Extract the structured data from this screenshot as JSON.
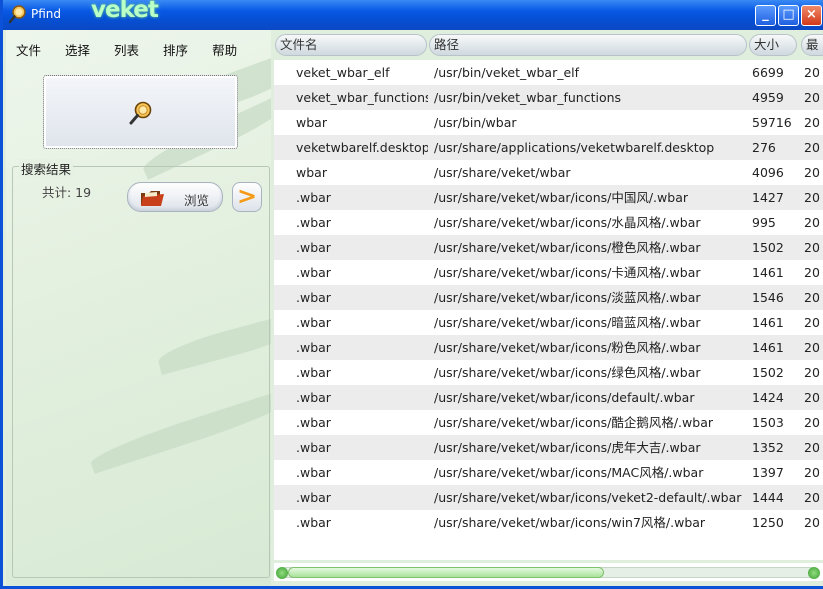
{
  "window": {
    "title": "Pfind",
    "logo_text": "veket",
    "controls": {
      "minimize": "_",
      "maximize": "□",
      "close": "×"
    }
  },
  "menu": [
    "文件",
    "选择",
    "列表",
    "排序",
    "帮助"
  ],
  "search_panel": {
    "search_icon": "magnifier-icon",
    "group_title": "搜索结果",
    "count_label": "共计: 19",
    "browse_label": "浏览",
    "next_symbol": ">"
  },
  "table": {
    "columns": [
      "文件名",
      "路径",
      "大小",
      "最"
    ],
    "rows": [
      [
        "veket_wbar_elf",
        "/usr/bin/veket_wbar_elf",
        "6699",
        "20"
      ],
      [
        "veket_wbar_functions",
        "/usr/bin/veket_wbar_functions",
        "4959",
        "20"
      ],
      [
        "wbar",
        "/usr/bin/wbar",
        "59716",
        "20"
      ],
      [
        "veketwbarelf.desktop",
        "/usr/share/applications/veketwbarelf.desktop",
        "276",
        "20"
      ],
      [
        "wbar",
        "/usr/share/veket/wbar",
        "4096",
        "20"
      ],
      [
        ".wbar",
        "/usr/share/veket/wbar/icons/中国风/.wbar",
        "1427",
        "20"
      ],
      [
        ".wbar",
        "/usr/share/veket/wbar/icons/水晶风格/.wbar",
        "995",
        "20"
      ],
      [
        ".wbar",
        "/usr/share/veket/wbar/icons/橙色风格/.wbar",
        "1502",
        "20"
      ],
      [
        ".wbar",
        "/usr/share/veket/wbar/icons/卡通风格/.wbar",
        "1461",
        "20"
      ],
      [
        ".wbar",
        "/usr/share/veket/wbar/icons/淡蓝风格/.wbar",
        "1546",
        "20"
      ],
      [
        ".wbar",
        "/usr/share/veket/wbar/icons/暗蓝风格/.wbar",
        "1461",
        "20"
      ],
      [
        ".wbar",
        "/usr/share/veket/wbar/icons/粉色风格/.wbar",
        "1461",
        "20"
      ],
      [
        ".wbar",
        "/usr/share/veket/wbar/icons/绿色风格/.wbar",
        "1502",
        "20"
      ],
      [
        ".wbar",
        "/usr/share/veket/wbar/icons/default/.wbar",
        "1424",
        "20"
      ],
      [
        ".wbar",
        "/usr/share/veket/wbar/icons/酷企鹅风格/.wbar",
        "1503",
        "20"
      ],
      [
        ".wbar",
        "/usr/share/veket/wbar/icons/虎年大吉/.wbar",
        "1352",
        "20"
      ],
      [
        ".wbar",
        "/usr/share/veket/wbar/icons/MAC风格/.wbar",
        "1397",
        "20"
      ],
      [
        ".wbar",
        "/usr/share/veket/wbar/icons/veket2-default/.wbar",
        "1444",
        "20"
      ],
      [
        ".wbar",
        "/usr/share/veket/wbar/icons/win7风格/.wbar",
        "1250",
        "20"
      ]
    ]
  },
  "colors": {
    "titlebar": "#0550d6",
    "pane_bg": "#dfeedd",
    "row_alt": "#ececec",
    "accent_orange": "#f59b1a",
    "scroll_green": "#a8e29a"
  }
}
